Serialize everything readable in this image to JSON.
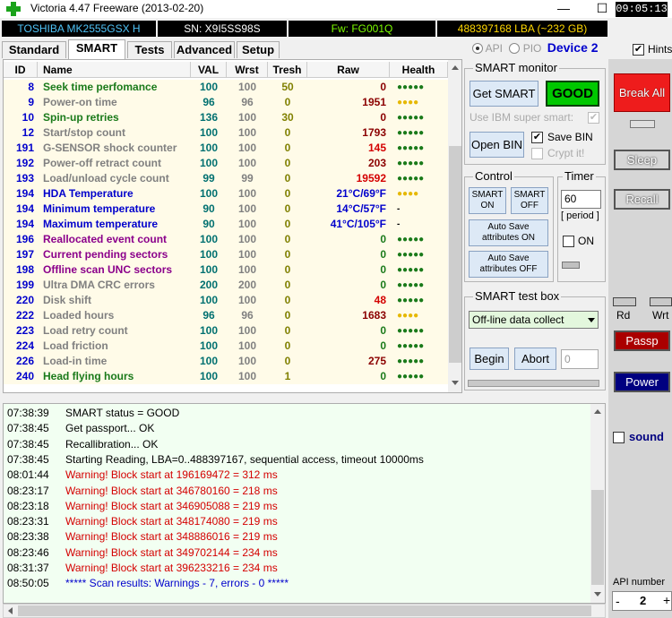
{
  "window": {
    "title": "Victoria 4.47  Freeware (2013-02-20)",
    "minimize": "—",
    "maximize": "☐",
    "close": "✕",
    "clock": "09:05:13"
  },
  "infobar": {
    "model": "TOSHIBA MK2555GSX H",
    "serial": "SN: X9I5SS98S",
    "firmware": "Fw: FG001Q",
    "lba": "488397168 LBA (~232 GB)"
  },
  "tabs": [
    "Standard",
    "SMART",
    "Tests",
    "Advanced",
    "Setup"
  ],
  "api": {
    "api_label": "API",
    "pio_label": "PIO",
    "device_label": "Device 2",
    "hints_label": "Hints"
  },
  "smart_table": {
    "headers": [
      "ID",
      "Name",
      "VAL",
      "Wrst",
      "Tresh",
      "Raw",
      "Health"
    ],
    "rows": [
      {
        "id": "8",
        "name": "Seek time perfomance",
        "val": "100",
        "wrst": "100",
        "tresh": "50",
        "raw": "0",
        "health": "●●●●●",
        "name_color": "#1a7a1a",
        "health_color": "#1a7a1a",
        "raw_color": "#8b0000"
      },
      {
        "id": "9",
        "name": "Power-on time",
        "val": "96",
        "wrst": "96",
        "tresh": "0",
        "raw": "1951",
        "health": "●●●●",
        "name_color": "#808080",
        "health_color": "#e6b800",
        "raw_color": "#8b0000"
      },
      {
        "id": "10",
        "name": "Spin-up retries",
        "val": "136",
        "wrst": "100",
        "tresh": "30",
        "raw": "0",
        "health": "●●●●●",
        "name_color": "#1a7a1a",
        "health_color": "#1a7a1a",
        "raw_color": "#8b0000"
      },
      {
        "id": "12",
        "name": "Start/stop count",
        "val": "100",
        "wrst": "100",
        "tresh": "0",
        "raw": "1793",
        "health": "●●●●●",
        "name_color": "#808080",
        "health_color": "#1a7a1a",
        "raw_color": "#8b0000"
      },
      {
        "id": "191",
        "name": "G-SENSOR shock counter",
        "val": "100",
        "wrst": "100",
        "tresh": "0",
        "raw": "145",
        "health": "●●●●●",
        "name_color": "#808080",
        "health_color": "#1a7a1a",
        "raw_color": "#d40000"
      },
      {
        "id": "192",
        "name": "Power-off retract count",
        "val": "100",
        "wrst": "100",
        "tresh": "0",
        "raw": "203",
        "health": "●●●●●",
        "name_color": "#808080",
        "health_color": "#1a7a1a",
        "raw_color": "#8b0000"
      },
      {
        "id": "193",
        "name": "Load/unload cycle count",
        "val": "99",
        "wrst": "99",
        "tresh": "0",
        "raw": "19592",
        "health": "●●●●●",
        "name_color": "#808080",
        "health_color": "#1a7a1a",
        "raw_color": "#d40000"
      },
      {
        "id": "194",
        "name": "HDA Temperature",
        "val": "100",
        "wrst": "100",
        "tresh": "0",
        "raw": "21°C/69°F",
        "health": "●●●●",
        "name_color": "#0000cc",
        "health_color": "#e6b800",
        "raw_color": "#0000cc"
      },
      {
        "id": "194",
        "name": "Minimum temperature",
        "val": "90",
        "wrst": "100",
        "tresh": "0",
        "raw": "14°C/57°F",
        "health": "-",
        "name_color": "#0000cc",
        "health_color": "#000000",
        "raw_color": "#0000cc"
      },
      {
        "id": "194",
        "name": "Maximum temperature",
        "val": "90",
        "wrst": "100",
        "tresh": "0",
        "raw": "41°C/105°F",
        "health": "-",
        "name_color": "#0000cc",
        "health_color": "#000000",
        "raw_color": "#0000cc"
      },
      {
        "id": "196",
        "name": "Reallocated event count",
        "val": "100",
        "wrst": "100",
        "tresh": "0",
        "raw": "0",
        "health": "●●●●●",
        "name_color": "#8b008b",
        "health_color": "#1a7a1a",
        "raw_color": "#1a7a1a"
      },
      {
        "id": "197",
        "name": "Current pending sectors",
        "val": "100",
        "wrst": "100",
        "tresh": "0",
        "raw": "0",
        "health": "●●●●●",
        "name_color": "#8b008b",
        "health_color": "#1a7a1a",
        "raw_color": "#1a7a1a"
      },
      {
        "id": "198",
        "name": "Offline scan UNC sectors",
        "val": "100",
        "wrst": "100",
        "tresh": "0",
        "raw": "0",
        "health": "●●●●●",
        "name_color": "#8b008b",
        "health_color": "#1a7a1a",
        "raw_color": "#1a7a1a"
      },
      {
        "id": "199",
        "name": "Ultra DMA CRC errors",
        "val": "200",
        "wrst": "200",
        "tresh": "0",
        "raw": "0",
        "health": "●●●●●",
        "name_color": "#808080",
        "health_color": "#1a7a1a",
        "raw_color": "#1a7a1a"
      },
      {
        "id": "220",
        "name": "Disk shift",
        "val": "100",
        "wrst": "100",
        "tresh": "0",
        "raw": "48",
        "health": "●●●●●",
        "name_color": "#808080",
        "health_color": "#1a7a1a",
        "raw_color": "#d40000"
      },
      {
        "id": "222",
        "name": "Loaded hours",
        "val": "96",
        "wrst": "96",
        "tresh": "0",
        "raw": "1683",
        "health": "●●●●",
        "name_color": "#808080",
        "health_color": "#e6b800",
        "raw_color": "#8b0000"
      },
      {
        "id": "223",
        "name": "Load retry count",
        "val": "100",
        "wrst": "100",
        "tresh": "0",
        "raw": "0",
        "health": "●●●●●",
        "name_color": "#808080",
        "health_color": "#1a7a1a",
        "raw_color": "#1a7a1a"
      },
      {
        "id": "224",
        "name": "Load friction",
        "val": "100",
        "wrst": "100",
        "tresh": "0",
        "raw": "0",
        "health": "●●●●●",
        "name_color": "#808080",
        "health_color": "#1a7a1a",
        "raw_color": "#1a7a1a"
      },
      {
        "id": "226",
        "name": "Load-in time",
        "val": "100",
        "wrst": "100",
        "tresh": "0",
        "raw": "275",
        "health": "●●●●●",
        "name_color": "#808080",
        "health_color": "#1a7a1a",
        "raw_color": "#8b0000"
      },
      {
        "id": "240",
        "name": "Head flying hours",
        "val": "100",
        "wrst": "100",
        "tresh": "1",
        "raw": "0",
        "health": "●●●●●",
        "name_color": "#1a7a1a",
        "health_color": "#1a7a1a",
        "raw_color": "#1a7a1a"
      }
    ]
  },
  "smart_monitor": {
    "title": "SMART monitor",
    "get_smart": "Get SMART",
    "status": "GOOD",
    "use_ibm": "Use IBM super smart:",
    "open_bin": "Open BIN",
    "save_bin": "Save BIN",
    "crypt": "Crypt it!"
  },
  "control": {
    "title": "Control",
    "smart_on": "SMART\nON",
    "smart_off": "SMART\nOFF",
    "autosave_on": "Auto Save\nattributes ON",
    "autosave_off": "Auto Save\nattributes OFF"
  },
  "timer": {
    "title": "Timer",
    "value": "60",
    "period": "[ period ]",
    "on_label": "ON"
  },
  "test_box": {
    "title": "SMART test box",
    "selected": "Off-line data collect",
    "begin": "Begin",
    "abort": "Abort",
    "value": "0"
  },
  "log": [
    {
      "time": "07:38:39",
      "msg": "SMART status = GOOD",
      "color": "#000000"
    },
    {
      "time": "07:38:45",
      "msg": "Get passport... OK",
      "color": "#000000"
    },
    {
      "time": "07:38:45",
      "msg": "Recallibration... OK",
      "color": "#000000"
    },
    {
      "time": "07:38:45",
      "msg": "Starting Reading, LBA=0..488397167, sequential access, timeout 10000ms",
      "color": "#000000"
    },
    {
      "time": "08:01:44",
      "msg": "Warning! Block start at 196169472 = 312 ms",
      "color": "#d40000"
    },
    {
      "time": "08:23:17",
      "msg": "Warning! Block start at 346780160 = 218 ms",
      "color": "#d40000"
    },
    {
      "time": "08:23:18",
      "msg": "Warning! Block start at 346905088 = 219 ms",
      "color": "#d40000"
    },
    {
      "time": "08:23:31",
      "msg": "Warning! Block start at 348174080 = 219 ms",
      "color": "#d40000"
    },
    {
      "time": "08:23:38",
      "msg": "Warning! Block start at 348886016 = 219 ms",
      "color": "#d40000"
    },
    {
      "time": "08:23:46",
      "msg": "Warning! Block start at 349702144 = 234 ms",
      "color": "#d40000"
    },
    {
      "time": "08:31:37",
      "msg": "Warning! Block start at 396233216 = 234 ms",
      "color": "#d40000"
    },
    {
      "time": "08:50:05",
      "msg": "***** Scan results: Warnings - 7, errors - 0 *****",
      "color": "#0000cc"
    }
  ],
  "right": {
    "break_all": "Break All",
    "sleep": "Sleep",
    "recall": "Recall",
    "rd": "Rd",
    "wrt": "Wrt",
    "passp": "Passp",
    "power": "Power",
    "sound": "sound",
    "api_number_label": "API number",
    "api_number": "2",
    "minus": "-",
    "plus": "+"
  },
  "colors": {
    "good_green": "#00c800",
    "break_red": "#ee1c1c",
    "passp_red": "#aa0000",
    "power_blue": "#000080"
  }
}
